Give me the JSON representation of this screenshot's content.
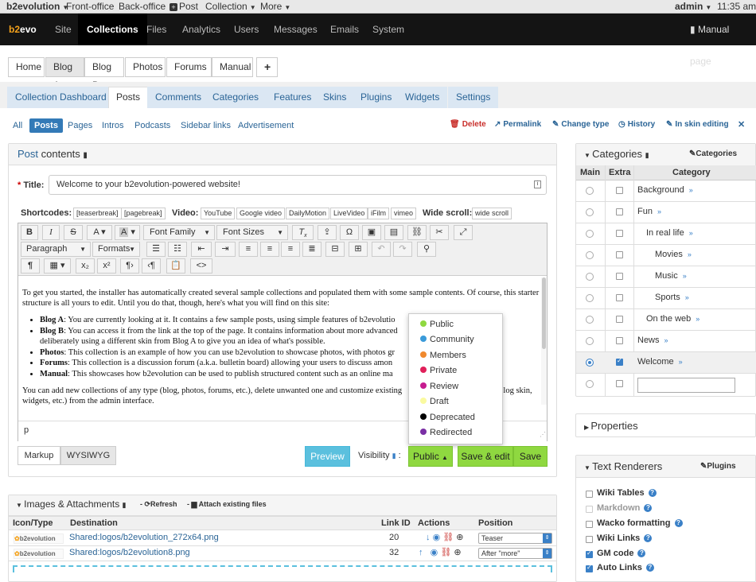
{
  "topbar": {
    "brand": "b2evolution",
    "frontoffice": "Front-office",
    "backoffice": "Back-office",
    "post": "Post",
    "collection": "Collection",
    "more": "More",
    "user": "admin",
    "time": "11:35 am"
  },
  "mainnav": {
    "logo_b2": "b2",
    "logo_evo": "evo",
    "items": [
      "Site",
      "Collections",
      "Files",
      "Analytics",
      "Users",
      "Messages",
      "Emails",
      "System"
    ],
    "manual": "Manual page"
  },
  "collection_tabs": [
    "Home",
    "Blog A",
    "Blog B",
    "Photos",
    "Forums",
    "Manual",
    "+"
  ],
  "subtabs": [
    "Collection Dashboard",
    "Posts",
    "Comments",
    "Categories",
    "Features",
    "Skins",
    "Plugins",
    "Widgets",
    "Settings"
  ],
  "type_tabs": [
    "All",
    "Posts",
    "Pages",
    "Intros",
    "Podcasts",
    "Sidebar links",
    "Advertisement"
  ],
  "actions": {
    "delete": "Delete",
    "permalink": "Permalink",
    "change_type": "Change type",
    "history": "History",
    "inskin": "In skin editing",
    "close": "✕"
  },
  "post": {
    "heading_a": "Post",
    "heading_b": "contents",
    "title_label": "Title:",
    "title_value": "Welcome to your b2evolution-powered website!"
  },
  "shortcodes": {
    "label": "Shortcodes:",
    "items": [
      "[teaserbreak]",
      "[pagebreak]"
    ],
    "video_label": "Video:",
    "videos": [
      "YouTube",
      "Google video",
      "DailyMotion",
      "LiveVideo",
      "iFilm",
      "vimeo"
    ],
    "wide_label": "Wide scroll:",
    "wide": "wide scroll"
  },
  "toolbar": {
    "font_family": "Font Family",
    "font_sizes": "Font Sizes",
    "paragraph": "Paragraph",
    "formats": "Formats"
  },
  "editor": {
    "intro": "To get you started, the installer has automatically created several sample collections and populated them with some sample contents. Of course, this starter structure is all yours to edit. Until you do that, though, here's what you will find on this site:",
    "items": [
      {
        "b": "Blog A",
        "t": ": You are currently looking at it. It contains a few sample posts, using simple features of b2evolutio"
      },
      {
        "b": "Blog B",
        "t": ": You can access it from the link at the top of the page. It contains information about more advanced"
      },
      {
        "b": "",
        "t": "deliberately using a different skin from Blog A to give you an idea of what's possible."
      },
      {
        "b": "Photos",
        "t": ": This collection is an example of how you can use b2evolution to showcase photos, with photos gr"
      },
      {
        "b": "Forums",
        "t": ": This collection is a discussion forum (a.k.a. bulletin board) allowing your users to discuss amon"
      },
      {
        "b": "Manual",
        "t": ": This showcases how b2evolution can be used to publish structured content such as an online ma"
      }
    ],
    "outro1": "You can add new collections of any type (blog, photos, forums, etc.), delete unwanted one and customize existing",
    "outro1b": "olog skin,",
    "outro2": "widgets, etc.) from the admin interface.",
    "status": "p"
  },
  "visibility": {
    "options": [
      {
        "label": "Public",
        "color": "#8fd840"
      },
      {
        "label": "Community",
        "color": "#3a9ad9"
      },
      {
        "label": "Members",
        "color": "#f0892e"
      },
      {
        "label": "Private",
        "color": "#e0205a"
      },
      {
        "label": "Review",
        "color": "#c61b8f"
      },
      {
        "label": "Draft",
        "color": "#fafaa0"
      },
      {
        "label": "Deprecated",
        "color": "#000000"
      },
      {
        "label": "Redirected",
        "color": "#7a2fa5"
      }
    ]
  },
  "buttons": {
    "markup": "Markup",
    "wysiwyg": "WYSIWYG",
    "preview": "Preview",
    "visibility_label": "Visibility",
    "public": "Public",
    "save_edit": "Save & edit",
    "save": "Save"
  },
  "attachments": {
    "title": "Images & Attachments",
    "refresh": "Refresh",
    "attach": "Attach existing files",
    "headers": [
      "Icon/Type",
      "Destination",
      "Link ID",
      "Actions",
      "Position"
    ],
    "rows": [
      {
        "icon": "b2evolution",
        "dest": "Shared:logos/b2evolution_272x64.png",
        "id": "20",
        "pos": "Teaser"
      },
      {
        "icon": "b2evolution",
        "dest": "Shared:logos/b2evolution8.png",
        "id": "32",
        "pos": "After \"more\""
      }
    ]
  },
  "categories": {
    "title": "Categories",
    "link": "Categories",
    "headers": [
      "Main",
      "Extra",
      "Category"
    ],
    "rows": [
      {
        "name": "Background",
        "indent": 0,
        "main": false,
        "extra": false
      },
      {
        "name": "Fun",
        "indent": 0,
        "main": false,
        "extra": false
      },
      {
        "name": "In real life",
        "indent": 1,
        "main": false,
        "extra": false
      },
      {
        "name": "Movies",
        "indent": 2,
        "main": false,
        "extra": false
      },
      {
        "name": "Music",
        "indent": 2,
        "main": false,
        "extra": false
      },
      {
        "name": "Sports",
        "indent": 2,
        "main": false,
        "extra": false
      },
      {
        "name": "On the web",
        "indent": 1,
        "main": false,
        "extra": false
      },
      {
        "name": "News",
        "indent": 0,
        "main": false,
        "extra": false
      },
      {
        "name": "Welcome",
        "indent": 0,
        "main": true,
        "extra": true
      }
    ]
  },
  "properties": {
    "title": "Properties"
  },
  "renderers": {
    "title": "Text Renderers",
    "link": "Plugins",
    "items": [
      {
        "label": "Wiki Tables",
        "checked": false,
        "disabled": false
      },
      {
        "label": "Markdown",
        "checked": false,
        "disabled": true
      },
      {
        "label": "Wacko formatting",
        "checked": false,
        "disabled": false
      },
      {
        "label": "Wiki Links",
        "checked": false,
        "disabled": false
      },
      {
        "label": "GM code",
        "checked": true,
        "disabled": false
      },
      {
        "label": "Auto Links",
        "checked": true,
        "disabled": false
      }
    ]
  }
}
